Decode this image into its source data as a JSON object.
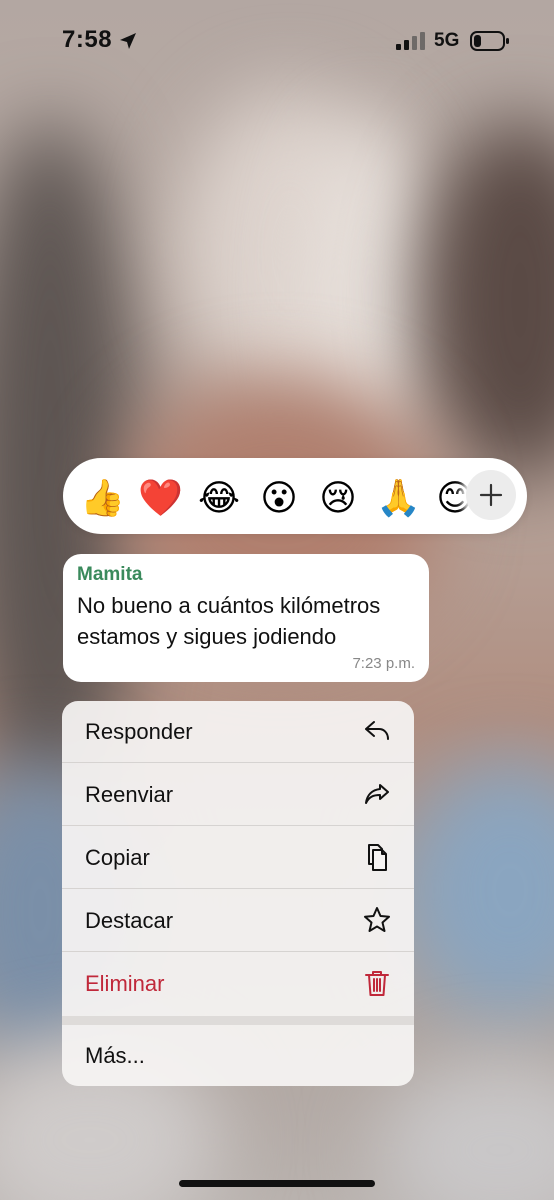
{
  "status_bar": {
    "time": "7:58",
    "network": "5G",
    "location_icon": "location-arrow-icon",
    "signal_icon": "cellular-signal-icon",
    "battery_icon": "battery-low-icon"
  },
  "reactions": {
    "emojis": [
      "👍",
      "❤️",
      "😂",
      "😮",
      "😢",
      "🙏",
      "😊"
    ],
    "more_icon": "plus-icon"
  },
  "message": {
    "sender": "Mamita",
    "text": "No bueno a cuántos kilómetros estamos y sigues jodiendo",
    "time": "7:23 p.m.",
    "sender_color": "#3a8a5c"
  },
  "menu": {
    "items": [
      {
        "label": "Responder",
        "icon": "reply-icon"
      },
      {
        "label": "Reenviar",
        "icon": "forward-icon"
      },
      {
        "label": "Copiar",
        "icon": "copy-icon"
      },
      {
        "label": "Destacar",
        "icon": "star-icon"
      },
      {
        "label": "Eliminar",
        "icon": "trash-icon",
        "color": "#c0283a"
      }
    ],
    "more_label": "Más..."
  }
}
